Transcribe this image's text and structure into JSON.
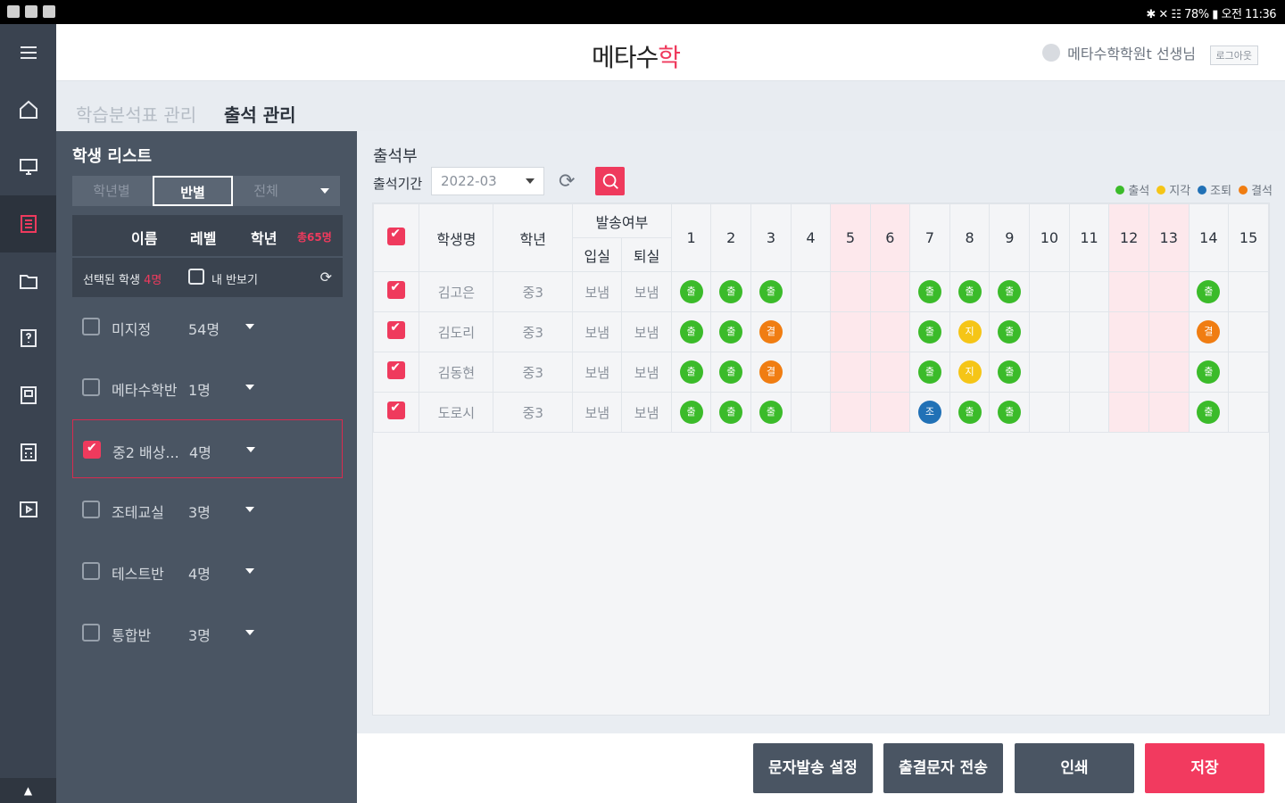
{
  "status_bar": {
    "right_text": "✱ ✕ ☷ 78% ▮ 오전 11:36"
  },
  "header": {
    "logo_main": "메타수",
    "logo_accent": "학",
    "user_name": "메타수학학원t 선생님",
    "logout_label": "로그아웃"
  },
  "tabs": [
    {
      "label": "학습분석표 관리"
    },
    {
      "label": "출석 관리"
    }
  ],
  "student_panel": {
    "title": "학생 리스트",
    "segments": [
      "학년별",
      "반별",
      "전체"
    ],
    "columns": [
      "이름",
      "레벨",
      "학년"
    ],
    "count_label": "총65명",
    "selected_label": "선택된 학생",
    "selected_count": "4명",
    "mine_label": "내 반보기",
    "classes": [
      {
        "name": "미지정",
        "count": "54명",
        "checked": false
      },
      {
        "name": "메타수학반",
        "count": "1명",
        "checked": false
      },
      {
        "name": "중2 배상...",
        "count": "4명",
        "checked": true
      },
      {
        "name": "조테교실",
        "count": "3명",
        "checked": false
      },
      {
        "name": "테스트반",
        "count": "4명",
        "checked": false
      },
      {
        "name": "통합반",
        "count": "3명",
        "checked": false
      }
    ]
  },
  "attendance": {
    "title": "출석부",
    "period_label": "출석기간",
    "period_value": "2022-03",
    "legend": [
      {
        "label": "출석",
        "color": "#3bbb2a"
      },
      {
        "label": "지각",
        "color": "#f5c517"
      },
      {
        "label": "조퇴",
        "color": "#2171b6"
      },
      {
        "label": "결석",
        "color": "#f07d12"
      }
    ],
    "headers": {
      "name": "학생명",
      "grade": "학년",
      "send": "발송여부",
      "in": "입실",
      "out": "퇴실",
      "days": [
        "1",
        "2",
        "3",
        "4",
        "5",
        "6",
        "7",
        "8",
        "9",
        "10",
        "11",
        "12",
        "13",
        "14",
        "15"
      ]
    },
    "pink_days": [
      5,
      6,
      12,
      13
    ],
    "rows": [
      {
        "name": "김고은",
        "grade": "중3",
        "in": "보냄",
        "out": "보냄",
        "marks": [
          "g",
          "g",
          "g",
          "",
          "",
          "",
          "g",
          "g",
          "g",
          "",
          "",
          "",
          "",
          "g",
          ""
        ]
      },
      {
        "name": "김도리",
        "grade": "중3",
        "in": "보냄",
        "out": "보냄",
        "marks": [
          "g",
          "g",
          "o",
          "",
          "",
          "",
          "g",
          "y",
          "g",
          "",
          "",
          "",
          "",
          "o",
          ""
        ]
      },
      {
        "name": "김동현",
        "grade": "중3",
        "in": "보냄",
        "out": "보냄",
        "marks": [
          "g",
          "g",
          "o",
          "",
          "",
          "",
          "g",
          "y",
          "g",
          "",
          "",
          "",
          "",
          "g",
          ""
        ]
      },
      {
        "name": "도로시",
        "grade": "중3",
        "in": "보냄",
        "out": "보냄",
        "marks": [
          "g",
          "g",
          "g",
          "",
          "",
          "",
          "b",
          "g",
          "g",
          "",
          "",
          "",
          "",
          "g",
          ""
        ]
      }
    ]
  },
  "buttons": {
    "sms_settings": "문자발송 설정",
    "send_attendance_sms": "출결문자 전송",
    "print": "인쇄",
    "save": "저장"
  }
}
